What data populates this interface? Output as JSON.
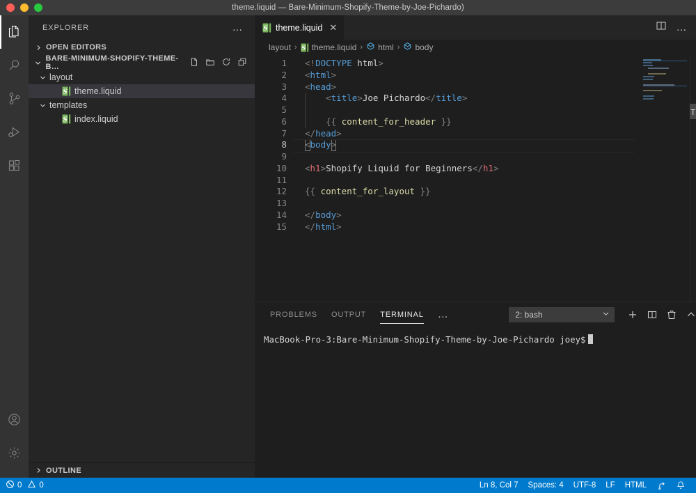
{
  "window": {
    "title": "theme.liquid — Bare-Minimum-Shopify-Theme-by-Joe-Pichardo)"
  },
  "activity_bar": {
    "items": [
      {
        "name": "explorer-icon",
        "label": "Explorer"
      },
      {
        "name": "search-icon",
        "label": "Search"
      },
      {
        "name": "source-control-icon",
        "label": "Source Control"
      },
      {
        "name": "run-and-debug-icon",
        "label": "Run and Debug"
      },
      {
        "name": "extensions-icon",
        "label": "Extensions"
      }
    ],
    "bottom_items": [
      {
        "name": "accounts-icon",
        "label": "Accounts"
      },
      {
        "name": "manage-gear-icon",
        "label": "Manage"
      }
    ]
  },
  "sidebar": {
    "title": "EXPLORER",
    "more_actions": "…",
    "open_editors": {
      "label": "OPEN EDITORS",
      "chevron": "›"
    },
    "project": {
      "label": "BARE-MINIMUM-SHOPIFY-THEME-B…",
      "chevron": "⌄",
      "actions": [
        "new-file-icon",
        "new-folder-icon",
        "refresh-icon",
        "collapse-all-icon"
      ]
    },
    "tree": [
      {
        "type": "folder",
        "label": "layout",
        "chevron": "⌄",
        "selected": false
      },
      {
        "type": "file",
        "label": "theme.liquid",
        "icon": "liquid-file-icon",
        "selected": true
      },
      {
        "type": "folder",
        "label": "templates",
        "chevron": "⌄",
        "selected": false
      },
      {
        "type": "file",
        "label": "index.liquid",
        "icon": "liquid-file-icon",
        "selected": false
      }
    ],
    "outline": {
      "label": "OUTLINE",
      "chevron": "›"
    }
  },
  "editor": {
    "tab": {
      "label": "theme.liquid",
      "icon": "liquid-file-icon",
      "close": "✕"
    },
    "tab_actions": [
      "split-editor-icon",
      "more-actions-icon"
    ],
    "breadcrumbs": [
      {
        "label": "layout",
        "icon": null
      },
      {
        "label": "theme.liquid",
        "icon": "liquid-file-icon"
      },
      {
        "label": "html",
        "icon": "symbol-field-icon"
      },
      {
        "label": "body",
        "icon": "symbol-field-icon"
      }
    ],
    "breadcrumb_separator": "›",
    "current_line": 8,
    "lines": [
      {
        "n": 1,
        "text": "<!DOCTYPE html>"
      },
      {
        "n": 2,
        "text": "<html>"
      },
      {
        "n": 3,
        "text": "<head>"
      },
      {
        "n": 4,
        "text": "    <title>Joe Pichardo</title>"
      },
      {
        "n": 5,
        "text": ""
      },
      {
        "n": 6,
        "text": "    {{ content_for_header }}"
      },
      {
        "n": 7,
        "text": "</head>"
      },
      {
        "n": 8,
        "text": "<body>"
      },
      {
        "n": 9,
        "text": ""
      },
      {
        "n": 10,
        "text": "<h1>Shopify Liquid for Beginners</h1>"
      },
      {
        "n": 11,
        "text": ""
      },
      {
        "n": 12,
        "text": "{{ content_for_layout }}"
      },
      {
        "n": 13,
        "text": ""
      },
      {
        "n": 14,
        "text": "</body>"
      },
      {
        "n": 15,
        "text": "</html>"
      }
    ]
  },
  "panel": {
    "tabs": [
      {
        "label": "PROBLEMS",
        "active": false
      },
      {
        "label": "OUTPUT",
        "active": false
      },
      {
        "label": "TERMINAL",
        "active": true
      }
    ],
    "more": "…",
    "terminal_select": {
      "value": "2: bash",
      "chevron": "⌄"
    },
    "actions": [
      "new-terminal-icon",
      "split-terminal-icon",
      "kill-terminal-icon",
      "maximize-panel-icon",
      "close-panel-icon"
    ],
    "terminal_text": "MacBook-Pro-3:Bare-Minimum-Shopify-Theme-by-Joe-Pichardo joey$"
  },
  "status_bar": {
    "errors": "0",
    "warnings": "0",
    "line_col": "Ln 8, Col 7",
    "spaces": "Spaces: 4",
    "encoding": "UTF-8",
    "eol": "LF",
    "language": "HTML",
    "feedback_icon": "feedback-icon",
    "bell_icon": "bell-icon"
  },
  "colors": {
    "accent": "#007acc",
    "tag": "#569cd6",
    "tag_alt": "#e06c75",
    "liquid_var": "#dcdcaa",
    "punctuation": "#808080",
    "text": "#d4d4d4",
    "liquid_green": "#7ab55c"
  }
}
